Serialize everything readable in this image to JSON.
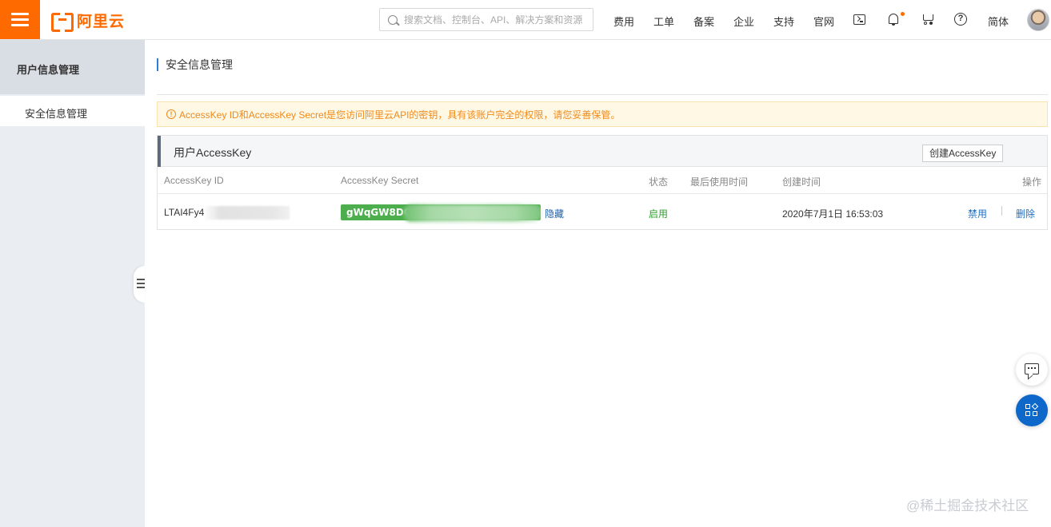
{
  "brand": {
    "logo_text": "阿里云",
    "accent_color": "#ff6a00"
  },
  "header": {
    "search_placeholder": "搜索文档、控制台、API、解决方案和资源",
    "nav": [
      "费用",
      "工单",
      "备案",
      "企业",
      "支持",
      "官网"
    ],
    "language": "简体",
    "icons": [
      "terminal-icon",
      "bell-icon",
      "cart-icon",
      "help-icon"
    ]
  },
  "sidebar": {
    "header": "用户信息管理",
    "items": [
      {
        "label": "安全信息管理",
        "active": true
      }
    ]
  },
  "main": {
    "title": "安全信息管理",
    "alert": "AccessKey ID和AccessKey Secret是您访问阿里云API的密钥，具有该账户完全的权限，请您妥善保管。",
    "panel": {
      "title": "用户AccessKey",
      "create_button": "创建AccessKey",
      "columns": [
        "AccessKey ID",
        "AccessKey Secret",
        "状态",
        "最后使用时间",
        "创建时间",
        "操作"
      ],
      "rows": [
        {
          "id": "LTAI4Fy4",
          "secret": "gWqGW8DO",
          "hide_label": "隐藏",
          "status": "启用",
          "last_used": "",
          "created": "2020年7月1日 16:53:03",
          "actions": [
            "禁用",
            "删除"
          ]
        }
      ]
    }
  },
  "watermark": "@稀土掘金技术社区"
}
